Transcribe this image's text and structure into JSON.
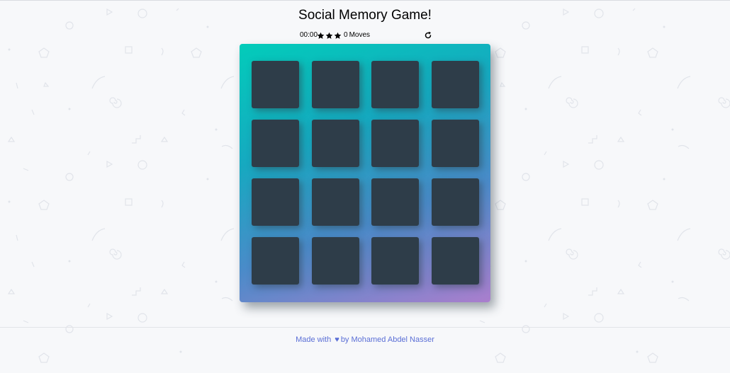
{
  "page": {
    "title": "Social Memory Game!"
  },
  "score_panel": {
    "timer": "00:00",
    "stars": [
      "star-icon",
      "star-icon",
      "star-icon"
    ],
    "moves_count": "0",
    "moves_label": "Moves",
    "restart_icon": "restart-icon"
  },
  "deck": {
    "rows": 4,
    "columns": 4,
    "card_state": "face-down",
    "colors": {
      "gradient_start": "#02ccba",
      "gradient_end": "#aa7ecd",
      "card_back": "#2e3d49"
    }
  },
  "footer": {
    "made_with": "Made with",
    "heart": "♥",
    "by": "by",
    "author": "Mohamed Abdel Nasser"
  },
  "colors": {
    "background": "#f7f8fa",
    "footer_text": "#5b6fd6"
  }
}
